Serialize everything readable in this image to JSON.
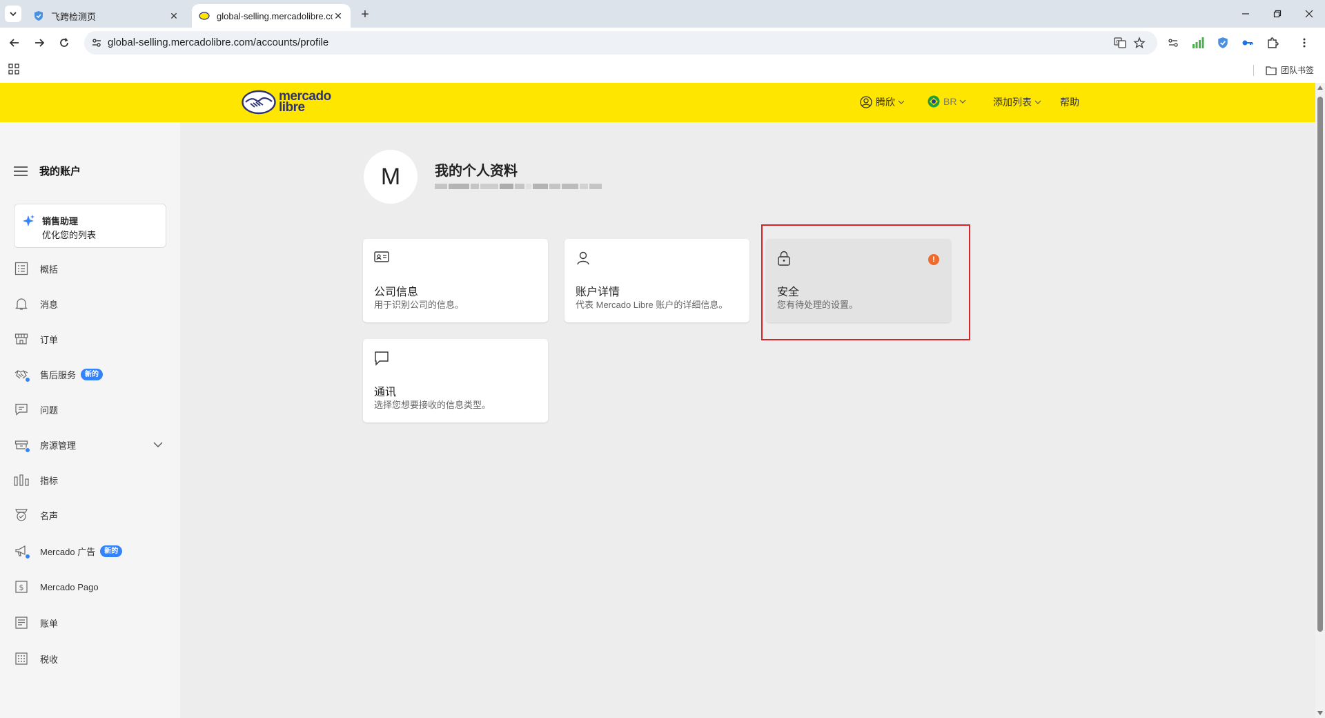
{
  "browser": {
    "tabs": [
      {
        "title": "飞跨检测页",
        "active": false
      },
      {
        "title": "global-selling.mercadolibre.com",
        "active": true
      }
    ],
    "url": "global-selling.mercadolibre.com/accounts/profile",
    "bookmark_folder": "团队书签"
  },
  "header": {
    "logo_line1": "mercado",
    "logo_line2": "libre",
    "user": "腾欣",
    "country": "BR",
    "add_listing": "添加列表",
    "help": "帮助",
    "brand_color": "#ffe600"
  },
  "sidebar": {
    "title": "我的账户",
    "assistant": {
      "title": "销售助理",
      "subtitle": "优化您的列表"
    },
    "items": [
      {
        "label": "概括",
        "icon": "list-icon"
      },
      {
        "label": "消息",
        "icon": "bell-icon"
      },
      {
        "label": "订单",
        "icon": "store-icon"
      },
      {
        "label": "售后服务",
        "icon": "handshake-icon",
        "badge": "新的"
      },
      {
        "label": "问题",
        "icon": "chat-icon"
      },
      {
        "label": "房源管理",
        "icon": "box-icon"
      },
      {
        "label": "指标",
        "icon": "bar-chart-icon"
      },
      {
        "label": "名声",
        "icon": "medal-icon"
      },
      {
        "label": "Mercado 广告",
        "icon": "megaphone-icon",
        "badge": "新的"
      },
      {
        "label": "Mercado Pago",
        "icon": "dollar-icon"
      },
      {
        "label": "账单",
        "icon": "receipt-icon"
      },
      {
        "label": "税收",
        "icon": "calculator-icon"
      }
    ]
  },
  "profile": {
    "avatar_initial": "M",
    "title": "我的个人资料"
  },
  "cards": [
    {
      "title": "公司信息",
      "desc": "用于识别公司的信息。",
      "icon": "id-card-icon"
    },
    {
      "title": "账户详情",
      "desc": "代表 Mercado Libre 账户的详细信息。",
      "icon": "user-icon"
    },
    {
      "title": "安全",
      "desc": "您有待处理的设置。",
      "icon": "lock-icon",
      "alert": "!"
    },
    {
      "title": "通讯",
      "desc": "选择您想要接收的信息类型。",
      "icon": "message-icon"
    }
  ]
}
